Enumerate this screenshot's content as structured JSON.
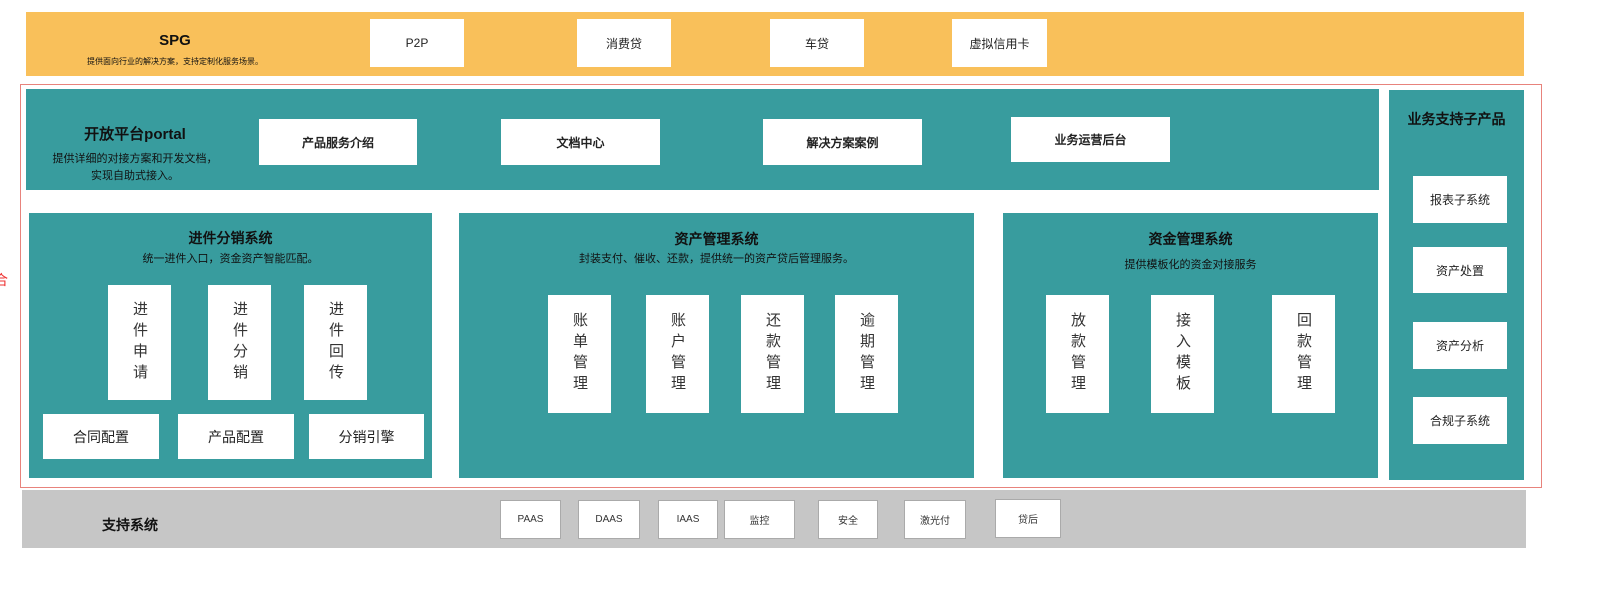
{
  "edge_char": "合",
  "spg": {
    "title": "SPG",
    "subtitle": "提供面向行业的解决方案，支持定制化服务场景。",
    "items": [
      "P2P",
      "消费贷",
      "车贷",
      "虚拟信用卡"
    ]
  },
  "portal": {
    "title": "开放平台portal",
    "subtitle1": "提供详细的对接方案和开发文档，",
    "subtitle2": "实现自助式接入。",
    "items": [
      "产品服务介绍",
      "文档中心",
      "解决方案案例",
      "业务运营后台"
    ]
  },
  "biz_support": {
    "title": "业务支持子产品",
    "items": [
      "报表子系统",
      "资产处置",
      "资产分析",
      "合规子系统"
    ]
  },
  "distribution": {
    "title": "进件分销系统",
    "subtitle": "统一进件入口，资金资产智能匹配。",
    "vertical": [
      "进件申请",
      "进件分销",
      "进件回传"
    ],
    "horizontal": [
      "合同配置",
      "产品配置",
      "分销引擎"
    ]
  },
  "asset": {
    "title": "资产管理系统",
    "subtitle": "封装支付、催收、还款，提供统一的资产贷后管理服务。",
    "items": [
      "账单管理",
      "账户管理",
      "还款管理",
      "逾期管理"
    ]
  },
  "fund": {
    "title": "资金管理系统",
    "subtitle": "提供模板化的资金对接服务",
    "items": [
      "放款管理",
      "接入模板",
      "回款管理"
    ]
  },
  "support": {
    "title": "支持系统",
    "items": [
      "PAAS",
      "DAAS",
      "IAAS",
      "监控",
      "安全",
      "激光付",
      "贷后"
    ]
  }
}
